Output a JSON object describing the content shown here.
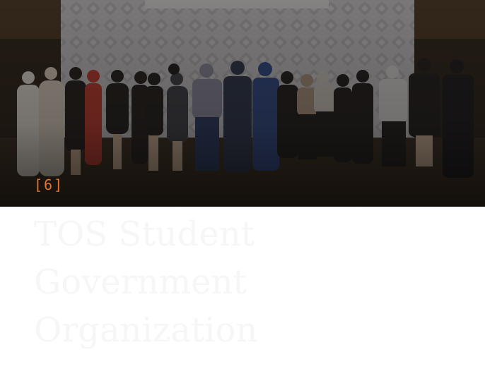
{
  "slide": {
    "index_label": "[6]",
    "title": "TOS Student Government Organization"
  },
  "colors": {
    "accent": "#e8742a",
    "title_text": "#f6f6f6",
    "background": "#ffffff",
    "photo_overlay": "#1b1713"
  }
}
